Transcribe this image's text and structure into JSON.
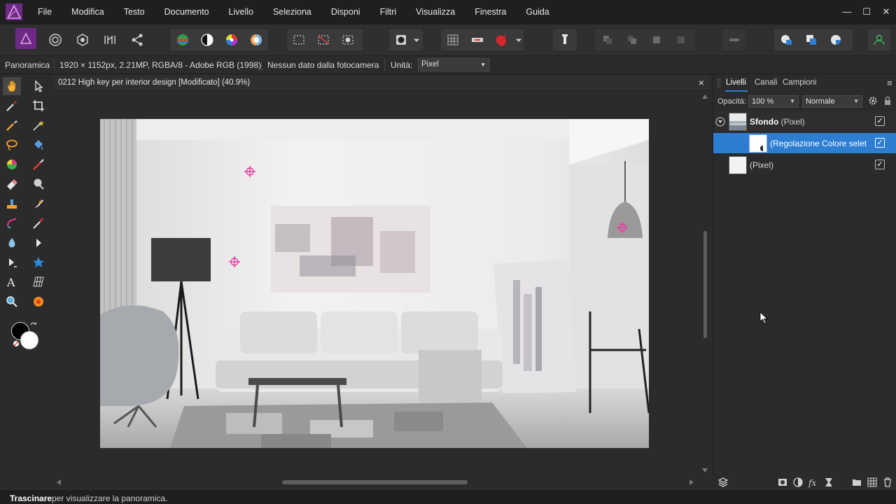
{
  "menu": {
    "items": [
      "File",
      "Modifica",
      "Testo",
      "Documento",
      "Livello",
      "Seleziona",
      "Disponi",
      "Filtri",
      "Visualizza",
      "Finestra",
      "Guida"
    ]
  },
  "window_controls": [
    "minimize-icon",
    "maximize-icon",
    "close-icon"
  ],
  "context": {
    "persona": "Panoramica",
    "doc_info": "1920 × 1152px, 2.21MP, RGBA/8 - Adobe RGB (1998)",
    "camera_info": "Nessun dato dalla fotocamera",
    "units_label": "Unità:",
    "units_value": "Pixel"
  },
  "document": {
    "title": "0212 High key per interior design [Modificato] (40.9%)",
    "close_symbol": "×"
  },
  "panel": {
    "tabs": [
      "Livelli",
      "Canali",
      "Campioni"
    ],
    "opacity_label": "Opacità:",
    "opacity_value": "100 %",
    "blend_mode": "Normale",
    "layers": [
      {
        "name": "Sfondo",
        "type": "(Pixel)",
        "visible": true
      },
      {
        "name": "(Regolazione Colore selet",
        "type": "",
        "visible": true,
        "selected": true
      },
      {
        "name": "(Pixel)",
        "type": "",
        "visible": true
      }
    ]
  },
  "status": {
    "bold": "Trascinare",
    "rest": "per visualizzare la panoramica."
  },
  "colors": {
    "accent": "#2d7dd2",
    "app_logo": "#7b2d8e",
    "marker": "#e040a0"
  }
}
